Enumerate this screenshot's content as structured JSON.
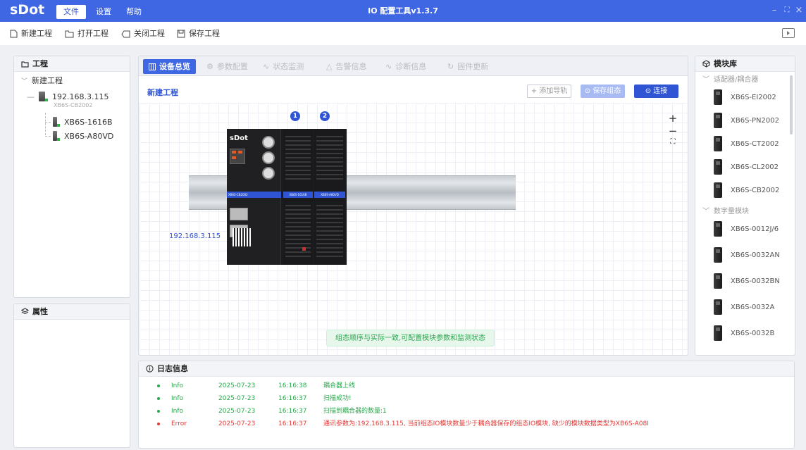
{
  "titlebar": {
    "logo": "sDot",
    "menus": [
      "文件",
      "设置",
      "帮助"
    ],
    "title": "IO 配置工具v1.3.7",
    "controls": [
      "–",
      "⛶",
      "×"
    ]
  },
  "toolbar": {
    "new": "新建工程",
    "open": "打开工程",
    "close": "关闭工程",
    "save": "保存工程"
  },
  "project_panel": {
    "title": "工程",
    "root": "新建工程",
    "coupler_ip": "192.168.3.115",
    "coupler_model": "XB6S-CB2002",
    "modules": [
      "XB6S-1616B",
      "XB6S-A80VD"
    ]
  },
  "props_panel": {
    "title": "属性"
  },
  "tabs": [
    "设备总览",
    "参数配置",
    "状态监测",
    "告警信息",
    "诊断信息",
    "固件更新"
  ],
  "overview": {
    "project_name": "新建工程",
    "add_rail": "添加导轨",
    "save_config": "保存组态",
    "connect": "连接",
    "slot_badges": [
      "1",
      "2"
    ],
    "device_ip": "192.168.3.115",
    "device_brand": "sDot",
    "module_labels": [
      "XB6S-CB2002",
      "XB6S-1616B",
      "XB6S-A80VD"
    ],
    "hint": "组态顺序与实际一致,可配置模块参数和监测状态",
    "zoom_in": "+",
    "zoom_out": "−"
  },
  "library": {
    "title": "模块库",
    "groups": [
      {
        "name": "适配器/耦合器",
        "items": [
          "XB6S-EI2002",
          "XB6S-PN2002",
          "XB6S-CT2002",
          "XB6S-CL2002",
          "XB6S-CB2002"
        ]
      },
      {
        "name": "数字量模块",
        "items": [
          "XB6S-0012J/6",
          "XB6S-0032AN",
          "XB6S-0032BN",
          "XB6S-0032A",
          "XB6S-0032B"
        ]
      }
    ]
  },
  "log": {
    "title": "日志信息",
    "rows": [
      {
        "level": "Info",
        "date": "2025-07-23",
        "time": "16:16:38",
        "msg": "耦合器上线",
        "color": "#2aa84d"
      },
      {
        "level": "Info",
        "date": "2025-07-23",
        "time": "16:16:37",
        "msg": "扫描成功!",
        "color": "#2aa84d"
      },
      {
        "level": "Info",
        "date": "2025-07-23",
        "time": "16:16:37",
        "msg": "扫描到耦合器的数量:1",
        "color": "#2aa84d"
      },
      {
        "level": "Error",
        "date": "2025-07-23",
        "time": "16:16:37",
        "msg": "通讯参数为:192.168.3.115, 当前组态IO模块数量少于耦合器保存的组态IO模块, 缺少的模块数据类型为XB6S-A08I",
        "color": "#e53935"
      }
    ]
  }
}
